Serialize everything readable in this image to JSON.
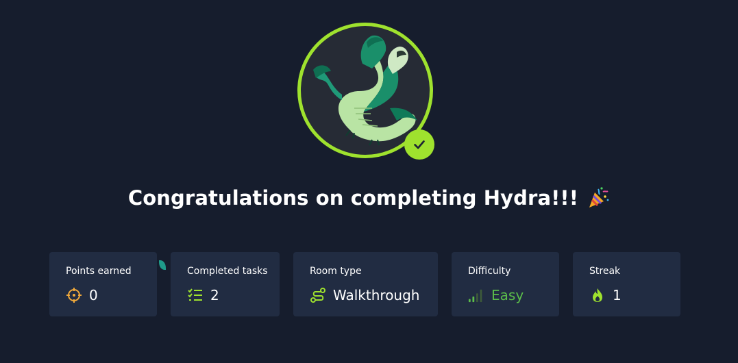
{
  "badge": {
    "name": "Hydra"
  },
  "title": "Congratulations on completing Hydra!!!",
  "stats": [
    {
      "label": "Points earned",
      "value": "0",
      "icon": "crosshair-icon"
    },
    {
      "label": "Completed tasks",
      "value": "2",
      "icon": "task-list-icon"
    },
    {
      "label": "Room type",
      "value": "Walkthrough",
      "icon": "route-icon"
    },
    {
      "label": "Difficulty",
      "value": "Easy",
      "icon": "signal-bars-icon"
    },
    {
      "label": "Streak",
      "value": "1",
      "icon": "flame-icon"
    }
  ],
  "colors": {
    "background": "#161d2d",
    "card": "#212c42",
    "accent": "#9fe22e",
    "easy": "#5bbd4a",
    "points_icon": "#f0a93b"
  }
}
